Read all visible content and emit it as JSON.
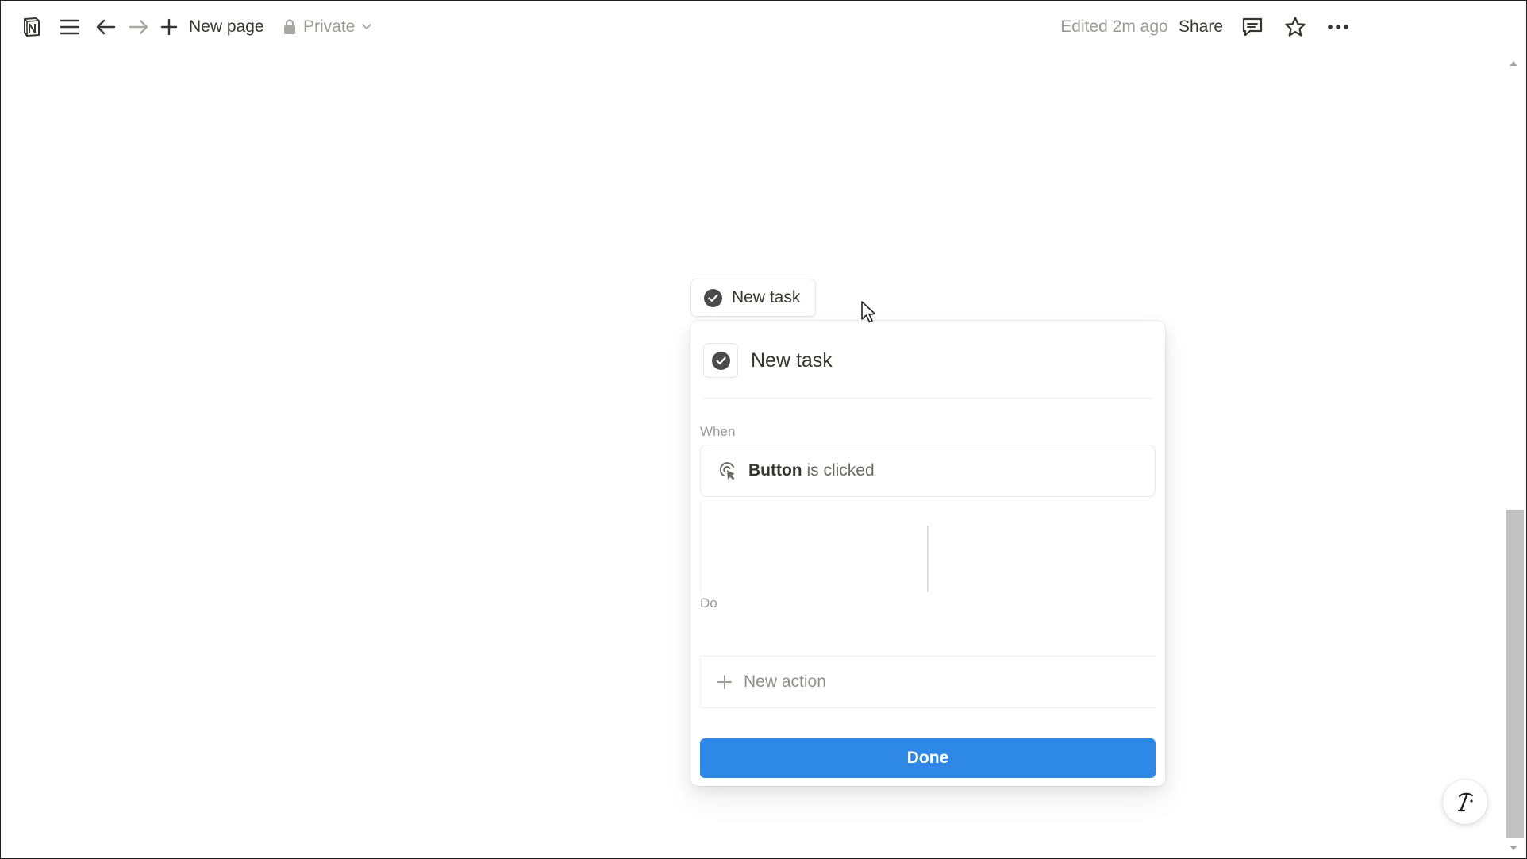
{
  "topbar": {
    "new_page_label": "New page",
    "privacy_label": "Private",
    "edited_label": "Edited 2m ago",
    "share_label": "Share"
  },
  "page": {
    "button_chip_label": "New task"
  },
  "popover": {
    "title": "New task",
    "when_label": "When",
    "trigger_bold": "Button",
    "trigger_rest": " is clicked",
    "do_label": "Do",
    "new_action_label": "New action",
    "done_label": "Done"
  },
  "icons": {
    "app_logo": "notion-logo-icon",
    "menu": "hamburger-icon",
    "back": "arrow-left-icon",
    "forward": "arrow-right-icon",
    "add": "plus-icon",
    "lock": "lock-icon",
    "comments": "comment-icon",
    "favorite": "star-icon",
    "more": "more-horizontal-icon",
    "check": "check-circle-icon",
    "trigger": "click-target-icon",
    "ai": "notion-ai-icon"
  },
  "colors": {
    "done_button": "#2e89e6",
    "text": "#37352f",
    "muted": "#9b9a97"
  }
}
